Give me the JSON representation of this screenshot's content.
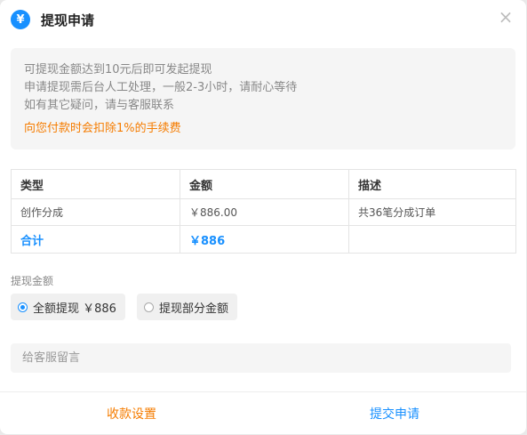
{
  "dialog": {
    "icon_glyph": "¥",
    "title": "提现申请",
    "close_glyph": "×"
  },
  "notice": {
    "lines": [
      "可提现金额达到10元后即可发起提现",
      "申请提现需后台人工处理，一般2-3小时，请耐心等待",
      "如有其它疑问，请与客服联系"
    ],
    "fee_note": "向您付款时会扣除1%的手续费"
  },
  "table": {
    "headers": [
      "类型",
      "金额",
      "描述"
    ],
    "rows": [
      [
        "创作分成",
        "￥886.00",
        "共36笔分成订单"
      ]
    ],
    "total": [
      "合计",
      "￥886",
      ""
    ]
  },
  "withdraw": {
    "label": "提现金额",
    "options": [
      {
        "label": "全额提现 ￥886",
        "checked": true
      },
      {
        "label": "提现部分金额",
        "checked": false
      }
    ]
  },
  "message": {
    "placeholder": "给客服留言",
    "value": ""
  },
  "footer": {
    "settings_label": "收款设置",
    "submit_label": "提交申请"
  },
  "colors": {
    "accent_blue": "#1890ff",
    "accent_orange": "#f57c00"
  }
}
